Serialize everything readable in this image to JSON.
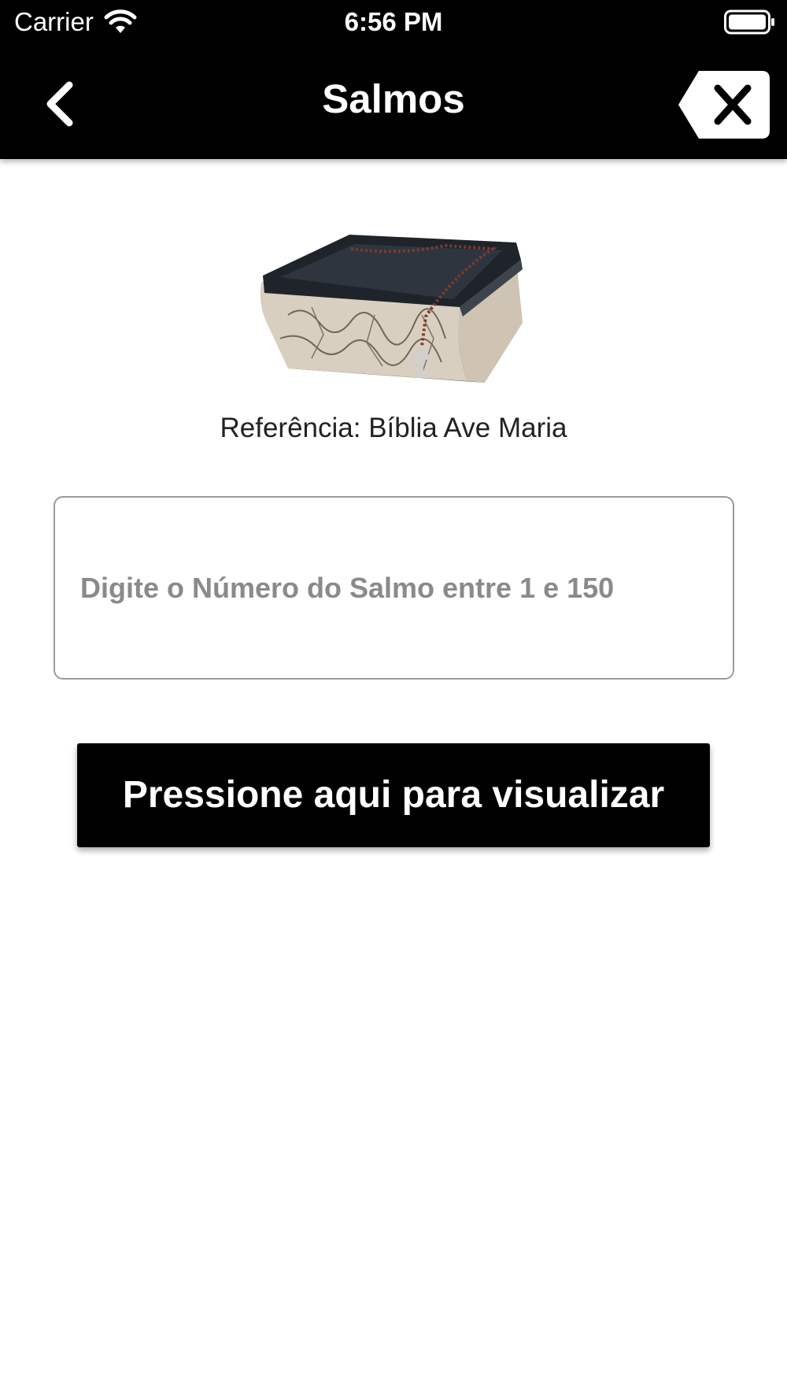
{
  "status_bar": {
    "carrier": "Carrier",
    "time": "6:56 PM",
    "icons": [
      "wifi-icon",
      "battery-icon"
    ]
  },
  "nav_bar": {
    "title": "Salmos",
    "back_icon": "chevron-left-icon",
    "clear_icon": "backspace-clear-icon"
  },
  "main": {
    "image": "bible-with-rosary-image",
    "reference": "Referência: Bíblia Ave Maria",
    "psalm_input": {
      "value": "",
      "placeholder": "Digite o Número do Salmo entre 1 e 150"
    },
    "view_button_label": "Pressione aqui para visualizar"
  },
  "colors": {
    "bar_background": "#000000",
    "page_background": "#ffffff",
    "button_background": "#000000",
    "button_text": "#ffffff",
    "placeholder_text": "#8a8a8a",
    "input_border": "#9a9a9a"
  }
}
